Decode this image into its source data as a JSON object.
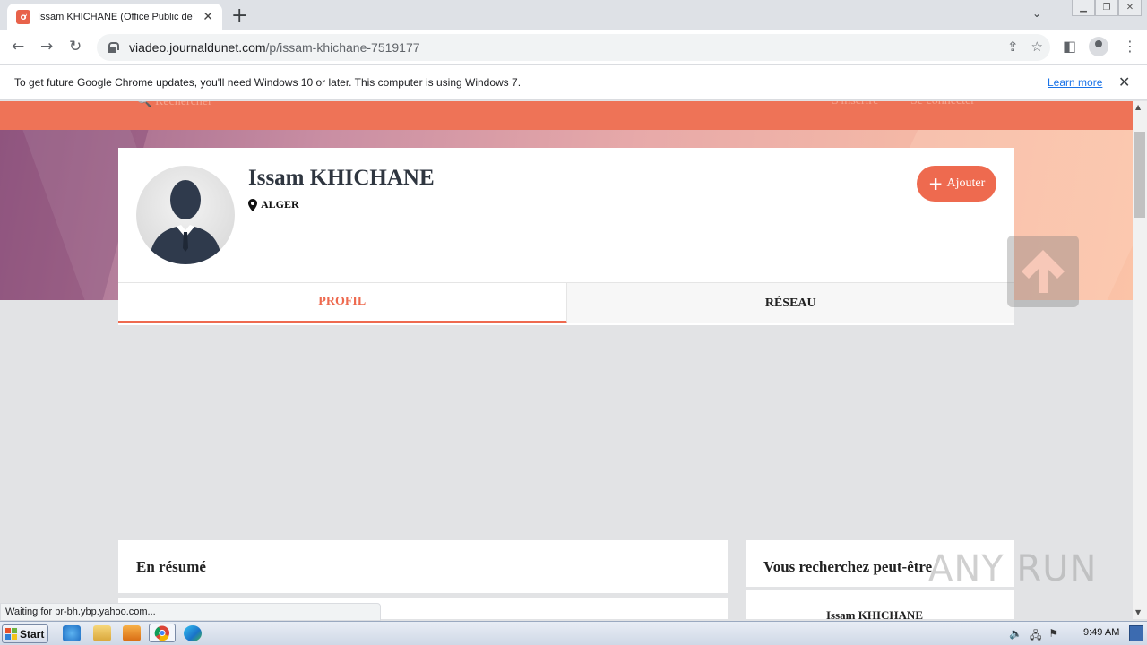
{
  "browser": {
    "tab_title": "Issam KHICHANE (Office Public de Tr",
    "tab_favicon_letter": "ơ",
    "url_host": "viadeo.journaldunet.com",
    "url_path": "/p/issam-khichane-7519177",
    "info_message": "To get future Google Chrome updates, you'll need Windows 10 or later. This computer is using Windows 7.",
    "learn_more": "Learn more",
    "status_text": "Waiting for pr-bh.ybp.yahoo.com..."
  },
  "header": {
    "search_ghost": "Rechercher",
    "signup_ghost": "S'inscrire",
    "login_ghost": "Se connecter"
  },
  "profile": {
    "name": "Issam KHICHANE",
    "location": "ALGER",
    "add_button": "Ajouter",
    "tabs": [
      "PROFIL",
      "RÉSEAU"
    ]
  },
  "sections": {
    "resume_title": "En résumé",
    "suggest_title": "Vous recherchez peut-être",
    "suggest_first": "Issam KHICHANE"
  },
  "watermark": "ANY RUN",
  "taskbar": {
    "start_label": "Start",
    "clock": "9:49 AM"
  },
  "colors": {
    "accent": "#ee6a4f",
    "orange_bar": "#ee7357"
  }
}
